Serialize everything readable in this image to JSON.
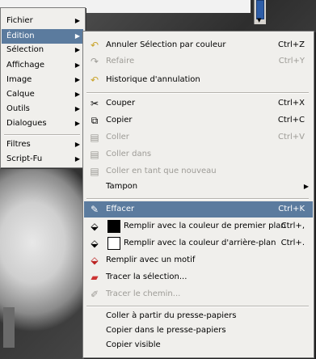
{
  "main_menu": {
    "items": [
      {
        "label": "Fichier",
        "active": false
      },
      {
        "label": "Édition",
        "active": true
      },
      {
        "label": "Sélection",
        "active": false
      },
      {
        "label": "Affichage",
        "active": false
      },
      {
        "label": "Image",
        "active": false
      },
      {
        "label": "Calque",
        "active": false
      },
      {
        "label": "Outils",
        "active": false
      },
      {
        "label": "Dialogues",
        "active": false
      },
      {
        "label": "Filtres",
        "active": false
      },
      {
        "label": "Script-Fu",
        "active": false
      }
    ]
  },
  "edit_menu": {
    "undo": {
      "label": "Annuler Sélection par couleur",
      "shortcut": "Ctrl+Z"
    },
    "redo": {
      "label": "Refaire",
      "shortcut": "Ctrl+Y"
    },
    "undo_history": {
      "label": "Historique d'annulation"
    },
    "cut": {
      "label": "Couper",
      "shortcut": "Ctrl+X"
    },
    "copy": {
      "label": "Copier",
      "shortcut": "Ctrl+C"
    },
    "paste": {
      "label": "Coller",
      "shortcut": "Ctrl+V"
    },
    "paste_into": {
      "label": "Coller dans"
    },
    "paste_as_new": {
      "label": "Coller en tant que nouveau"
    },
    "buffer": {
      "label": "Tampon"
    },
    "clear": {
      "label": "Effacer",
      "shortcut": "Ctrl+K"
    },
    "fill_fg": {
      "label": "Remplir avec la couleur de premier plan",
      "shortcut": "Ctrl+,"
    },
    "fill_bg": {
      "label": "Remplir avec la couleur d'arrière-plan",
      "shortcut": "Ctrl+."
    },
    "fill_pattern": {
      "label": "Remplir avec un motif"
    },
    "stroke_selection": {
      "label": "Tracer la sélection..."
    },
    "stroke_path": {
      "label": "Tracer le chemin..."
    },
    "paste_from_clipboard": {
      "label": "Coller à partir du presse-papiers"
    },
    "copy_to_clipboard": {
      "label": "Copier dans le presse-papiers"
    },
    "copy_visible": {
      "label": "Copier visible"
    }
  },
  "colors": {
    "highlight": "#5b7b9e",
    "menu_bg": "#f0efec",
    "disabled": "#9d9b96"
  }
}
